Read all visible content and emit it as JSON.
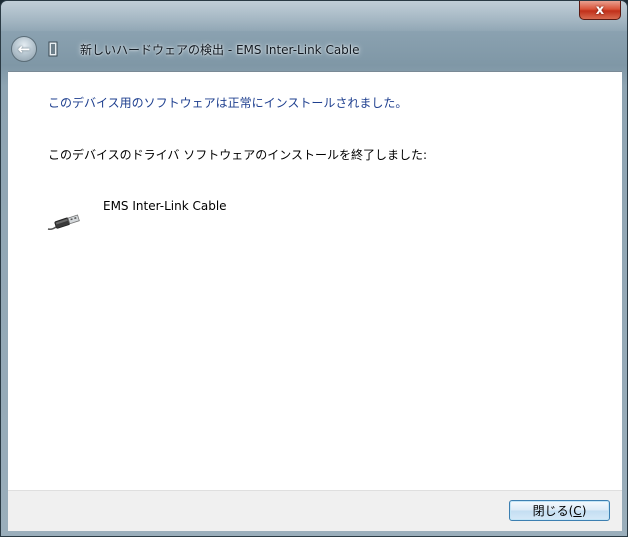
{
  "window": {
    "title": "新しいハードウェアの検出 - EMS Inter-Link Cable",
    "close_glyph": "x",
    "back_glyph": "←"
  },
  "content": {
    "heading": "このデバイス用のソフトウェアは正常にインストールされました。",
    "description": "このデバイスのドライバ ソフトウェアのインストールを終了しました:",
    "device_name": "EMS Inter-Link Cable",
    "device_icon": "usb-cable-icon"
  },
  "footer": {
    "close_label_prefix": "閉じる(",
    "close_label_mnemonic": "C",
    "close_label_suffix": ")"
  },
  "colors": {
    "heading": "#1e3f8f",
    "close_accent": "#d9543a"
  }
}
